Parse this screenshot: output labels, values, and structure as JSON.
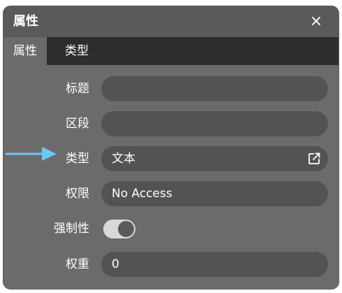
{
  "panel": {
    "title": "属性",
    "close_label": "×"
  },
  "tabs": [
    {
      "label": "属性",
      "active": true
    },
    {
      "label": "类型",
      "active": false
    }
  ],
  "fields": {
    "title_label": "标题",
    "title_value": "",
    "section_label": "区段",
    "section_value": "",
    "type_label": "类型",
    "type_value": "文本",
    "permission_label": "权限",
    "permission_value": "No Access",
    "mandatory_label": "强制性",
    "mandatory_on": true,
    "weight_label": "权重",
    "weight_value": "0"
  },
  "icons": {
    "close": "close-icon",
    "external_link": "external-link-icon",
    "arrow": "arrow-right-icon"
  },
  "colors": {
    "panel_bg": "#6b6b6b",
    "header_bg": "#5a5a5a",
    "tabbar_bg": "#2d2d2d",
    "field_bg": "#535353",
    "arrow": "#6ec6f5",
    "text": "#ffffff"
  }
}
